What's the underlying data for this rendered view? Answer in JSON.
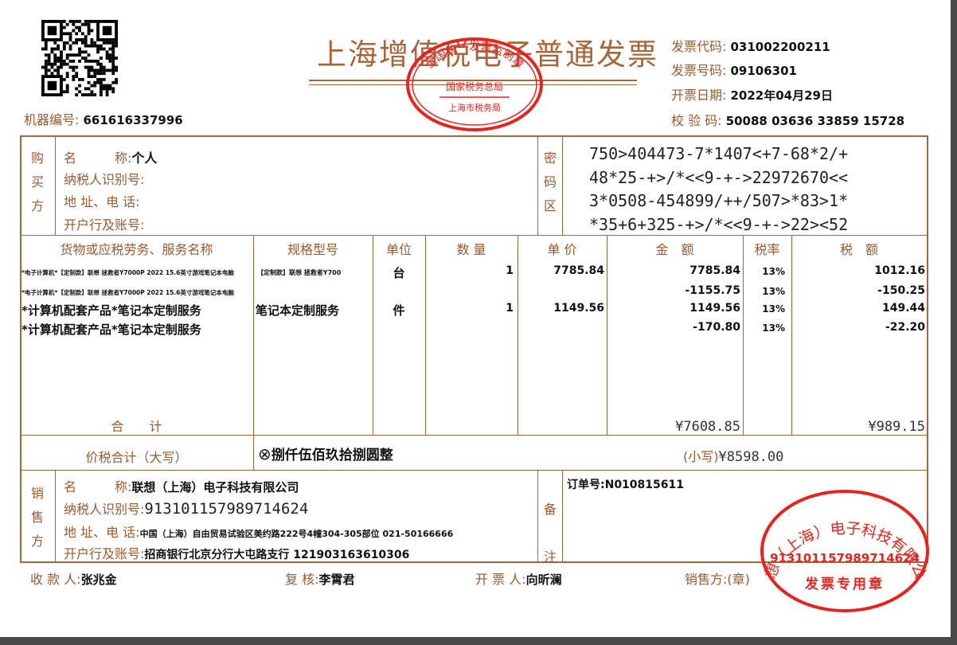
{
  "header": {
    "title": "上海增值税电子普通发票",
    "machine_no_label": "机器编号:",
    "machine_no": "661616337996",
    "invoice_code_label": "发票代码:",
    "invoice_code": "031002200211",
    "invoice_no_label": "发票号码:",
    "invoice_no": "09106301",
    "date_label": "开票日期:",
    "date": "2022年04月29日",
    "check_label": "校 验 码:",
    "check_code": "50088 03636 33859 15728"
  },
  "tax_stamp": {
    "top_text": "全国统一发票监制章",
    "middle_text": "国家税务总局",
    "bottom_text": "上海市税务局"
  },
  "buyer": {
    "side_label": [
      "购",
      "买",
      "方"
    ],
    "name_label": "名　　　称:",
    "name": "个人",
    "tax_id_label": "纳税人识别号:",
    "addr_label": "地 址、电 话:",
    "bank_label": "开户行及账号:"
  },
  "cipher": {
    "side_label": [
      "密",
      "码",
      "区"
    ],
    "lines": [
      "750>404473-7*1407<+7-68*2/+",
      "48*25-+>/*<<9-+->22972670<<",
      "3*0508-454899/++/507>*83>1*",
      "*35+6+325-+>/*<<9-+->22><52"
    ]
  },
  "items_header": {
    "name": "货物或应税劳务、服务名称",
    "spec": "规格型号",
    "unit": "单位",
    "qty": "数 量",
    "price": "单 价",
    "amount": "金　额",
    "rate": "税率",
    "tax": "税　额"
  },
  "items": [
    {
      "name": "*电子计算机*【定制款】联想 拯救者Y7000P 2022 15.6英寸游戏笔记本电脑",
      "spec": "【定制款】联想 拯救者Y700",
      "unit": "台",
      "qty": "1",
      "price": "7785.84",
      "amount": "7785.84",
      "rate": "13%",
      "tax": "1012.16",
      "small": true
    },
    {
      "name": "*电子计算机*【定制款】联想 拯救者Y7000P 2022 15.6英寸游戏笔记本电脑",
      "spec": "",
      "unit": "",
      "qty": "",
      "price": "",
      "amount": "-1155.75",
      "rate": "13%",
      "tax": "-150.25",
      "small": true
    },
    {
      "name": "*计算机配套产品*笔记本定制服务",
      "spec": "笔记本定制服务",
      "unit": "件",
      "qty": "1",
      "price": "1149.56",
      "amount": "1149.56",
      "rate": "13%",
      "tax": "149.44",
      "small": false
    },
    {
      "name": "*计算机配套产品*笔记本定制服务",
      "spec": "",
      "unit": "",
      "qty": "",
      "price": "",
      "amount": "-170.80",
      "rate": "13%",
      "tax": "-22.20",
      "small": false
    }
  ],
  "totals": {
    "label": "合　　计",
    "amount": "¥7608.85",
    "tax": "¥989.15",
    "words_label": "价税合计（大写）",
    "words_symbol": "⊗",
    "words": "捌仟伍佰玖拾捌圆整",
    "small_label": "(小写)",
    "small_value": "¥8598.00"
  },
  "seller": {
    "side_label": [
      "销",
      "售",
      "方"
    ],
    "name_label": "名　　　称:",
    "name": "联想（上海）电子科技有限公司",
    "tax_id_label": "纳税人识别号:",
    "tax_id": "913101157989714624",
    "addr_label": "地 址、电 话:",
    "addr": "中国（上海）自由贸易试验区美约路222号4幢304-305部位 021-50166666",
    "bank_label": "开户行及账号:",
    "bank": "招商银行北京分行大屯路支行 121903163610306"
  },
  "remarks": {
    "side_label": [
      "备",
      "注"
    ],
    "text": "订单号:N010815611"
  },
  "seller_stamp": {
    "company": "联想（上海）电子科技有限公司",
    "tax_id": "913101157989714624",
    "bottom": "发票专用章"
  },
  "footer": {
    "payee_label": "收 款 人:",
    "payee": "张兆金",
    "reviewer_label": "复 核:",
    "reviewer": "李霄君",
    "drawer_label": "开 票 人:",
    "drawer": "向昕澜",
    "seller_label": "销售方:(章)"
  },
  "colors": {
    "frame": "#a8653a",
    "label": "#9a5a2e",
    "stamp": "#e8231f"
  }
}
